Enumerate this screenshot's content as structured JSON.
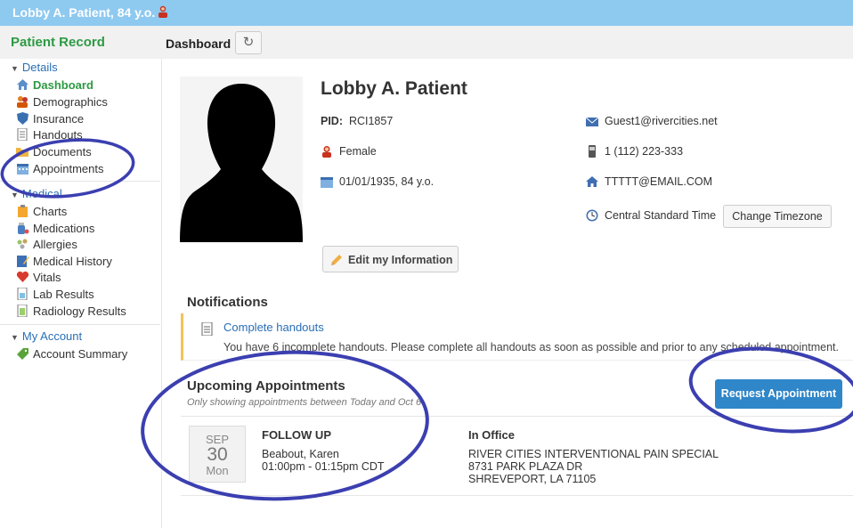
{
  "header": {
    "patient_title": "Lobby A. Patient, 84 y.o.",
    "record_title": "Patient Record",
    "page_title": "Dashboard"
  },
  "sidebar": {
    "details_label": "Details",
    "details_items": [
      {
        "label": "Dashboard",
        "icon": "home-icon"
      },
      {
        "label": "Demographics",
        "icon": "people-icon"
      },
      {
        "label": "Insurance",
        "icon": "shield-icon"
      },
      {
        "label": "Handouts",
        "icon": "document-icon"
      },
      {
        "label": "Documents",
        "icon": "folder-icon"
      },
      {
        "label": "Appointments",
        "icon": "calendar-icon"
      }
    ],
    "medical_label": "Medical",
    "medical_items": [
      {
        "label": "Charts",
        "icon": "clipboard-icon"
      },
      {
        "label": "Medications",
        "icon": "pills-icon"
      },
      {
        "label": "Allergies",
        "icon": "allergy-icon"
      },
      {
        "label": "Medical History",
        "icon": "history-icon"
      },
      {
        "label": "Vitals",
        "icon": "heart-icon"
      },
      {
        "label": "Lab Results",
        "icon": "lab-icon"
      },
      {
        "label": "Radiology Results",
        "icon": "radiology-icon"
      }
    ],
    "account_label": "My Account",
    "account_items": [
      {
        "label": "Account Summary",
        "icon": "tag-icon"
      }
    ]
  },
  "patient": {
    "name": "Lobby A. Patient",
    "pid_label": "PID:",
    "pid": "RCI1857",
    "gender": "Female",
    "dob": "01/01/1935, 84 y.o.",
    "email": "Guest1@rivercities.net",
    "phone": "1 (112) 223-333",
    "home_email": "TTTTT@EMAIL.COM",
    "timezone": "Central Standard Time",
    "change_timezone_label": "Change Timezone",
    "edit_label": "Edit my Information"
  },
  "notifications": {
    "heading": "Notifications",
    "items": [
      {
        "title": "Complete handouts",
        "text": "You have 6 incomplete handouts. Please complete all handouts as soon as possible and prior to any scheduled appointment."
      }
    ]
  },
  "appointments": {
    "heading": "Upcoming Appointments",
    "subtitle": "Only showing appointments between Today and Oct 6",
    "request_label": "Request Appointment",
    "items": [
      {
        "month": "SEP",
        "day": "30",
        "weekday": "Mon",
        "type": "FOLLOW UP",
        "provider": "Beabout, Karen",
        "time": "01:00pm - 01:15pm CDT",
        "location_type": "In Office",
        "facility": "RIVER CITIES INTERVENTIONAL PAIN SPECIAL",
        "address1": "8731 PARK PLAZA DR",
        "address2": "SHREVEPORT, LA 71105"
      }
    ]
  },
  "colors": {
    "topbar": "#8ec9f0",
    "record_green": "#2d9a43",
    "link_blue": "#2a6fb6",
    "primary_button": "#2f86c9",
    "notification_accent": "#f3c257",
    "annotation_ovals": "#3b3fb0"
  }
}
